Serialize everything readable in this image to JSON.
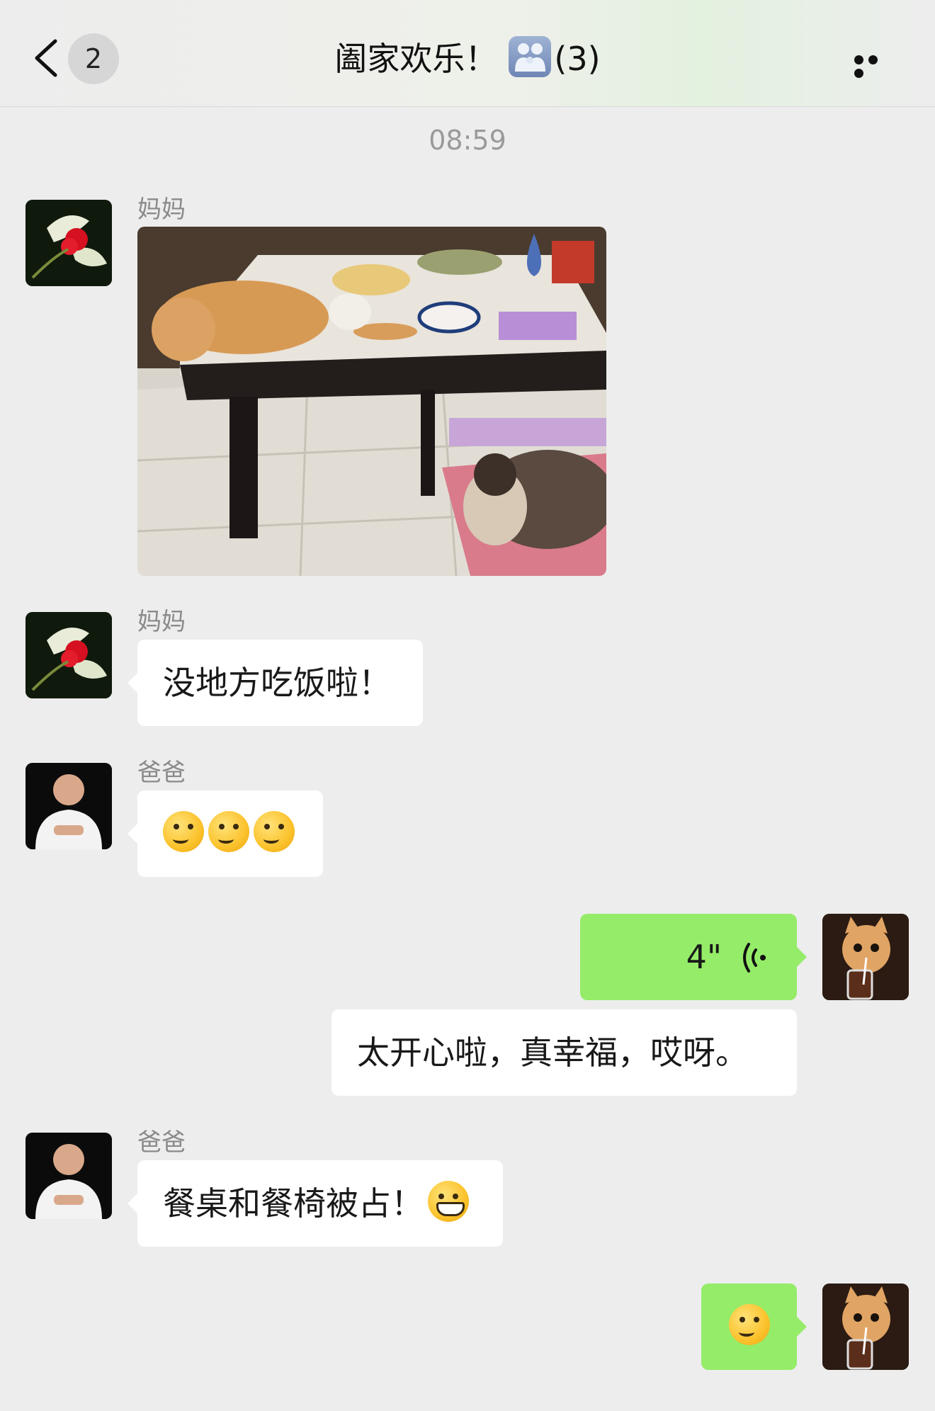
{
  "header": {
    "back_count": "2",
    "title": "阖家欢乐！",
    "member_count": "(3)"
  },
  "timestamp": "08:59",
  "icons": {
    "back": "chevron-left-icon",
    "group": "family-group-icon",
    "more": "more-dots-icon",
    "voice": "voice-wave-icon"
  },
  "colors": {
    "background": "#ededed",
    "self_bubble": "#95ec69",
    "other_bubble": "#ffffff"
  },
  "messages": [
    {
      "sender": "妈妈",
      "type": "image"
    },
    {
      "sender": "妈妈",
      "type": "text",
      "text": "没地方吃饭啦！"
    },
    {
      "sender": "爸爸",
      "type": "emoji",
      "emoji": "thinking-emoji ×3"
    },
    {
      "sender": "self",
      "type": "voice",
      "duration": "4\""
    },
    {
      "sender": "self",
      "type": "text",
      "text": "太开心啦，真幸福，哎呀。"
    },
    {
      "sender": "爸爸",
      "type": "text",
      "text": "餐桌和餐椅被占！"
    },
    {
      "sender": "self",
      "type": "emoji",
      "emoji": "thinking-emoji"
    }
  ]
}
